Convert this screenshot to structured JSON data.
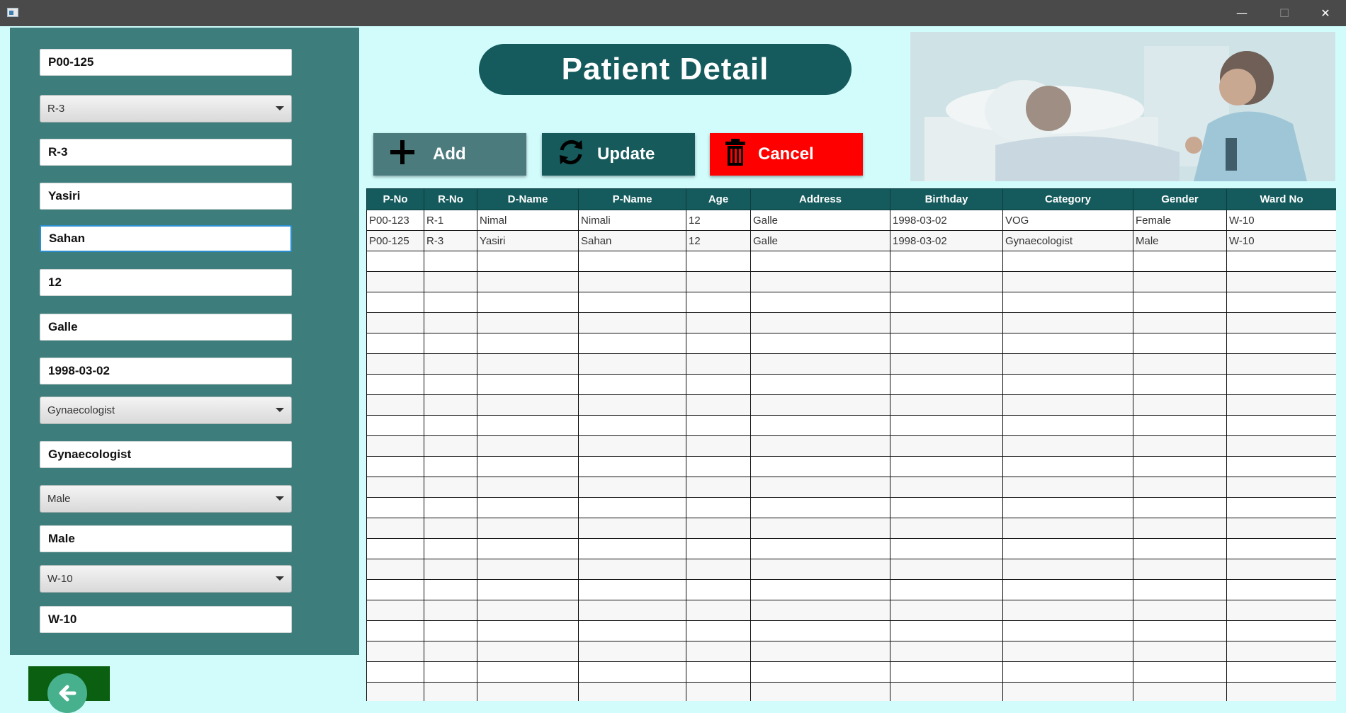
{
  "colors": {
    "titlebar": "#4a4a4a",
    "page_bg": "#d2fcfc",
    "left_panel": "#3d7e7c",
    "header_teal": "#155a5c",
    "add_button": "#4b7b7c",
    "update_button": "#165a5c",
    "cancel_button": "#ff0000",
    "back_button": "#0b5f10"
  },
  "window": {
    "minimize_glyph": "—",
    "maximize_glyph": "☐",
    "close_glyph": "✕"
  },
  "form": {
    "p_no": "P00-125",
    "r_no_select": "R-3",
    "r_no": "R-3",
    "d_name": "Yasiri",
    "p_name": "Sahan",
    "age": "12",
    "address": "Galle",
    "birthday": "1998-03-02",
    "category_select": "Gynaecologist",
    "category": "Gynaecologist",
    "gender_select": "Male",
    "gender": "Male",
    "ward_select": "W-10",
    "ward_no": "W-10"
  },
  "header": {
    "title": "Patient Detail"
  },
  "buttons": {
    "add": "Add",
    "update": "Update",
    "cancel": "Cancel"
  },
  "table": {
    "columns": [
      "P-No",
      "R-No",
      "D-Name",
      "P-Name",
      "Age",
      "Address",
      "Birthday",
      "Category",
      "Gender",
      "Ward No"
    ],
    "rows": [
      [
        "P00-123",
        "R-1",
        "Nimal",
        "Nimali",
        "12",
        "Galle",
        "1998-03-02",
        "VOG",
        "Female",
        "W-10"
      ],
      [
        "P00-125",
        "R-3",
        "Yasiri",
        "Sahan",
        "12",
        "Galle",
        "1998-03-02",
        "Gynaecologist",
        "Male",
        "W-10"
      ]
    ]
  },
  "icons": {
    "back": "arrow-left-icon",
    "add": "plus-icon",
    "update": "refresh-icon",
    "cancel": "trash-icon"
  }
}
